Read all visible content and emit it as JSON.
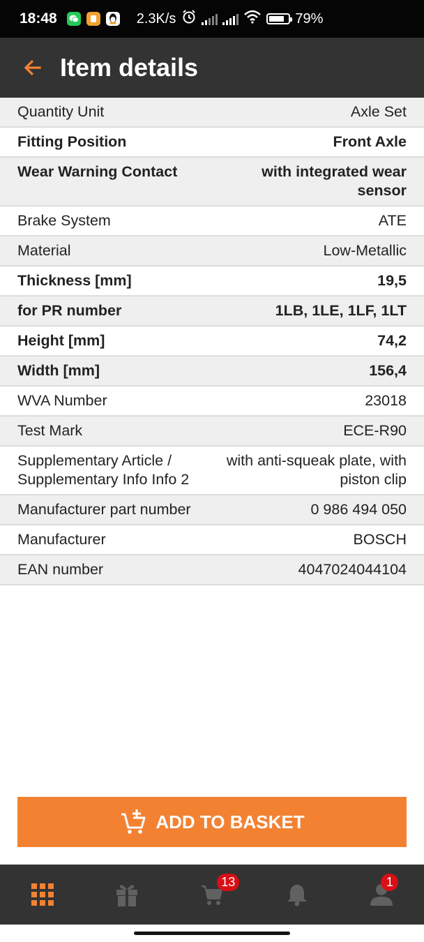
{
  "status_bar": {
    "time": "18:48",
    "net_speed": "2.3K/s",
    "battery": "79%"
  },
  "app_bar": {
    "title": "Item details"
  },
  "details": [
    {
      "label": "Quantity Unit",
      "value": "Axle Set"
    },
    {
      "label": "Fitting Position",
      "value": "Front Axle"
    },
    {
      "label": "Wear Warning Contact",
      "value": "with integrated wear sensor"
    },
    {
      "label": "Brake System",
      "value": "ATE"
    },
    {
      "label": "Material",
      "value": "Low-Metallic"
    },
    {
      "label": "Thickness [mm]",
      "value": "19,5"
    },
    {
      "label": "for PR number",
      "value": "1LB, 1LE, 1LF, 1LT"
    },
    {
      "label": "Height [mm]",
      "value": "74,2"
    },
    {
      "label": "Width [mm]",
      "value": "156,4"
    },
    {
      "label": "WVA Number",
      "value": "23018"
    },
    {
      "label": "Test Mark",
      "value": "ECE-R90"
    },
    {
      "label": "Supplementary Article /\nSupplementary Info Info 2",
      "value": "with anti-squeak plate, with piston clip"
    },
    {
      "label": "Manufacturer part number",
      "value": "0 986 494 050"
    },
    {
      "label": "Manufacturer",
      "value": "BOSCH"
    },
    {
      "label": "EAN number",
      "value": "4047024044104"
    }
  ],
  "basket_button": {
    "label": "ADD TO BASKET",
    "icon": "cart-plus-icon"
  },
  "bottom_nav": {
    "items": [
      {
        "name": "catalog",
        "icon": "grid-icon",
        "active": true
      },
      {
        "name": "offers",
        "icon": "gift-icon"
      },
      {
        "name": "cart",
        "icon": "cart-icon",
        "badge": "13"
      },
      {
        "name": "notifications",
        "icon": "bell-icon"
      },
      {
        "name": "account",
        "icon": "person-icon",
        "badge": "1"
      }
    ]
  },
  "colors": {
    "accent": "#f28232",
    "app_bar": "#333333",
    "badge": "#d90f16",
    "row_shade": "#efefef"
  }
}
